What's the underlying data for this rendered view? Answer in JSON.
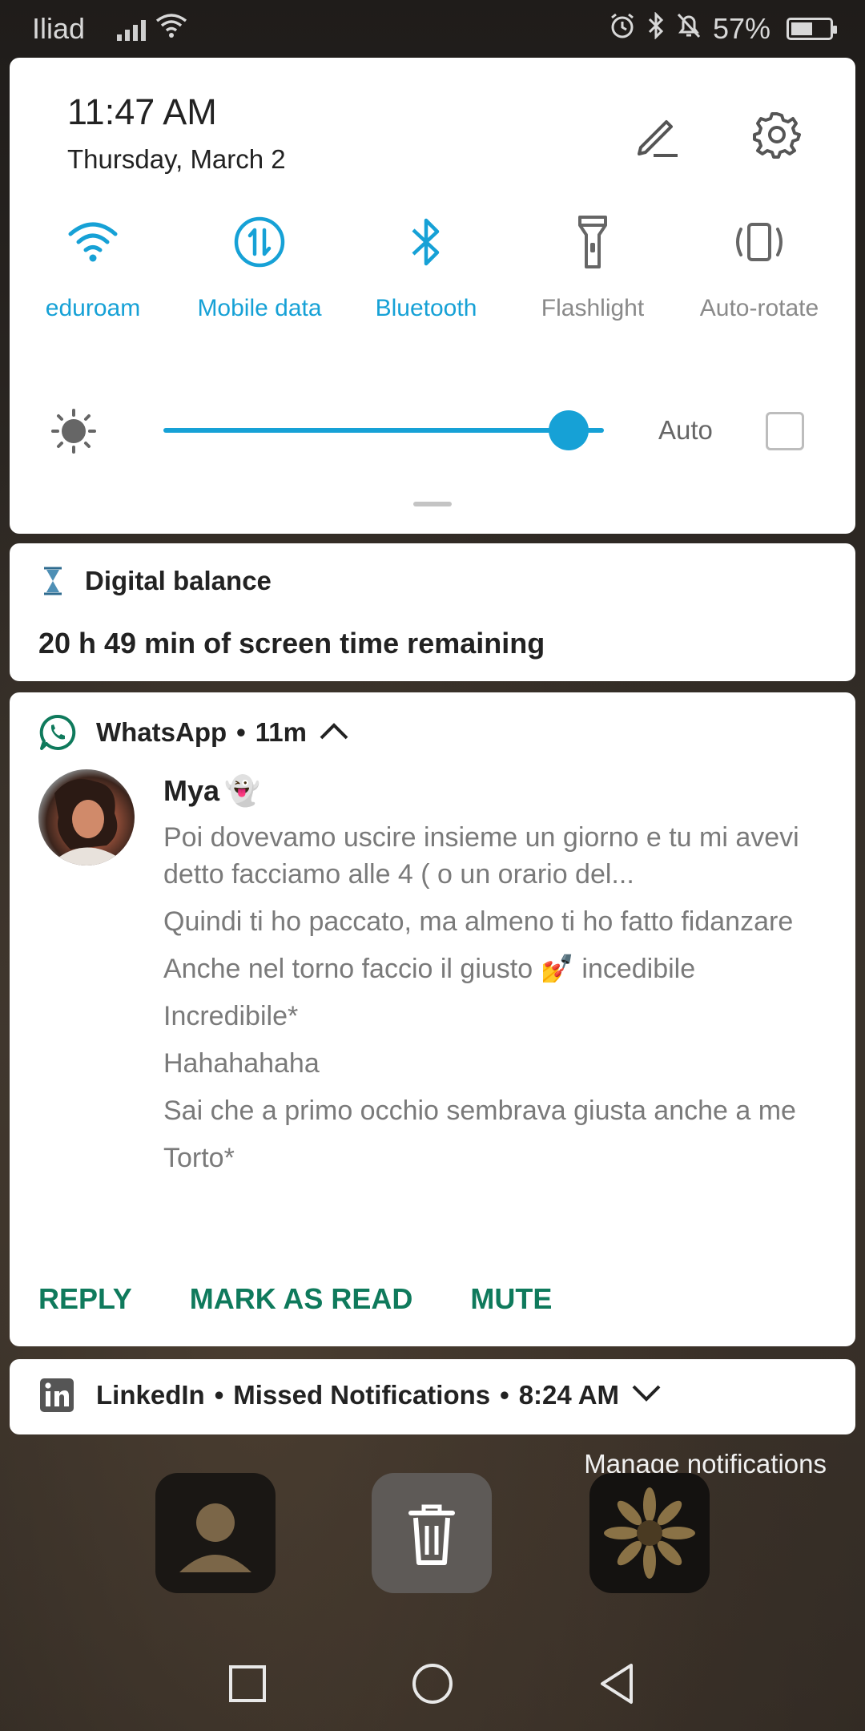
{
  "status_bar": {
    "carrier": "Iliad",
    "battery": "57%",
    "battery_level": 0.57
  },
  "quick_settings": {
    "time": "11:47 AM",
    "date": "Thursday, March 2",
    "tiles": [
      {
        "label": "eduroam",
        "icon": "wifi-icon",
        "active": true
      },
      {
        "label": "Mobile data",
        "icon": "mobile-data-icon",
        "active": true
      },
      {
        "label": "Bluetooth",
        "icon": "bluetooth-icon",
        "active": true
      },
      {
        "label": "Flashlight",
        "icon": "flashlight-icon",
        "active": false
      },
      {
        "label": "Auto-rotate",
        "icon": "auto-rotate-icon",
        "active": false
      }
    ],
    "brightness": {
      "level": 0.92,
      "auto_label": "Auto",
      "auto_checked": false
    }
  },
  "digital_balance": {
    "title": "Digital balance",
    "body": "20 h 49 min of screen time remaining"
  },
  "whatsapp": {
    "app": "WhatsApp",
    "age": "11m",
    "sender": "Mya",
    "sender_emoji": "👻",
    "messages": [
      "Poi dovevamo uscire insieme un giorno e tu mi avevi detto facciamo alle 4 ( o un orario del...",
      "Quindi ti ho paccato, ma almeno ti ho fatto fidanzare",
      "Anche nel torno faccio il giusto 💅 incedibile",
      "Incredibile*",
      "Hahahahaha",
      "Sai che a primo occhio sembrava giusta anche a me",
      "Torto*"
    ],
    "actions": {
      "reply": "REPLY",
      "mark_read": "MARK AS READ",
      "mute": "MUTE"
    }
  },
  "linkedin": {
    "app": "LinkedIn",
    "subtitle": "Missed Notifications",
    "time": "8:24 AM"
  },
  "manage_notifications": "Manage notifications",
  "colors": {
    "accent": "#16a1d6",
    "whatsapp_action": "#0f7a5c",
    "inactive": "#8a8a8a"
  }
}
